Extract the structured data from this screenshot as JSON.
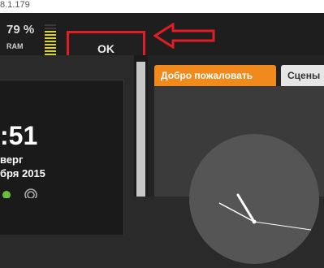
{
  "address": {
    "text": "8.1.179"
  },
  "ram": {
    "percent": "79 %",
    "label": "RAM",
    "level": 0.79,
    "meter_color": "#d9d13a"
  },
  "ok_button": {
    "label": "OK",
    "highlight_color": "#e01c24"
  },
  "clock_widget": {
    "time": ":51",
    "day": "верг",
    "date": "бря 2015"
  },
  "tabs": [
    {
      "label": "Добро пожаловать",
      "active": true
    },
    {
      "label": "Сцены",
      "active": false
    }
  ],
  "colors": {
    "accent_tab": "#f08a1d",
    "arrow": "#e01c24"
  },
  "icons": {
    "arrow": "left-arrow-icon",
    "analog_clock": "analog-clock-icon"
  }
}
